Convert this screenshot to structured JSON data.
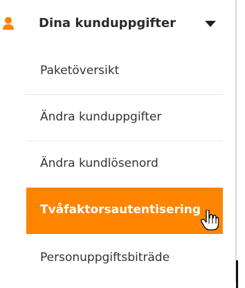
{
  "menu": {
    "header": {
      "label": "Dina kunduppgifter",
      "icon": "user-icon",
      "toggle_icon": "caret-down-icon"
    },
    "items": [
      {
        "label": "Paketöversikt",
        "active": false
      },
      {
        "label": "Ändra kunduppgifter",
        "active": false
      },
      {
        "label": "Ändra kundlösenord",
        "active": false
      },
      {
        "label": "Tvåfaktorsautentisering",
        "active": true
      },
      {
        "label": "Personuppgiftsbiträde",
        "active": false
      }
    ]
  },
  "cursor": {
    "icon": "hand-pointer-icon"
  },
  "colors": {
    "accent": "#ff8400",
    "text": "#2b2b2b",
    "active_text": "#ffffff"
  }
}
